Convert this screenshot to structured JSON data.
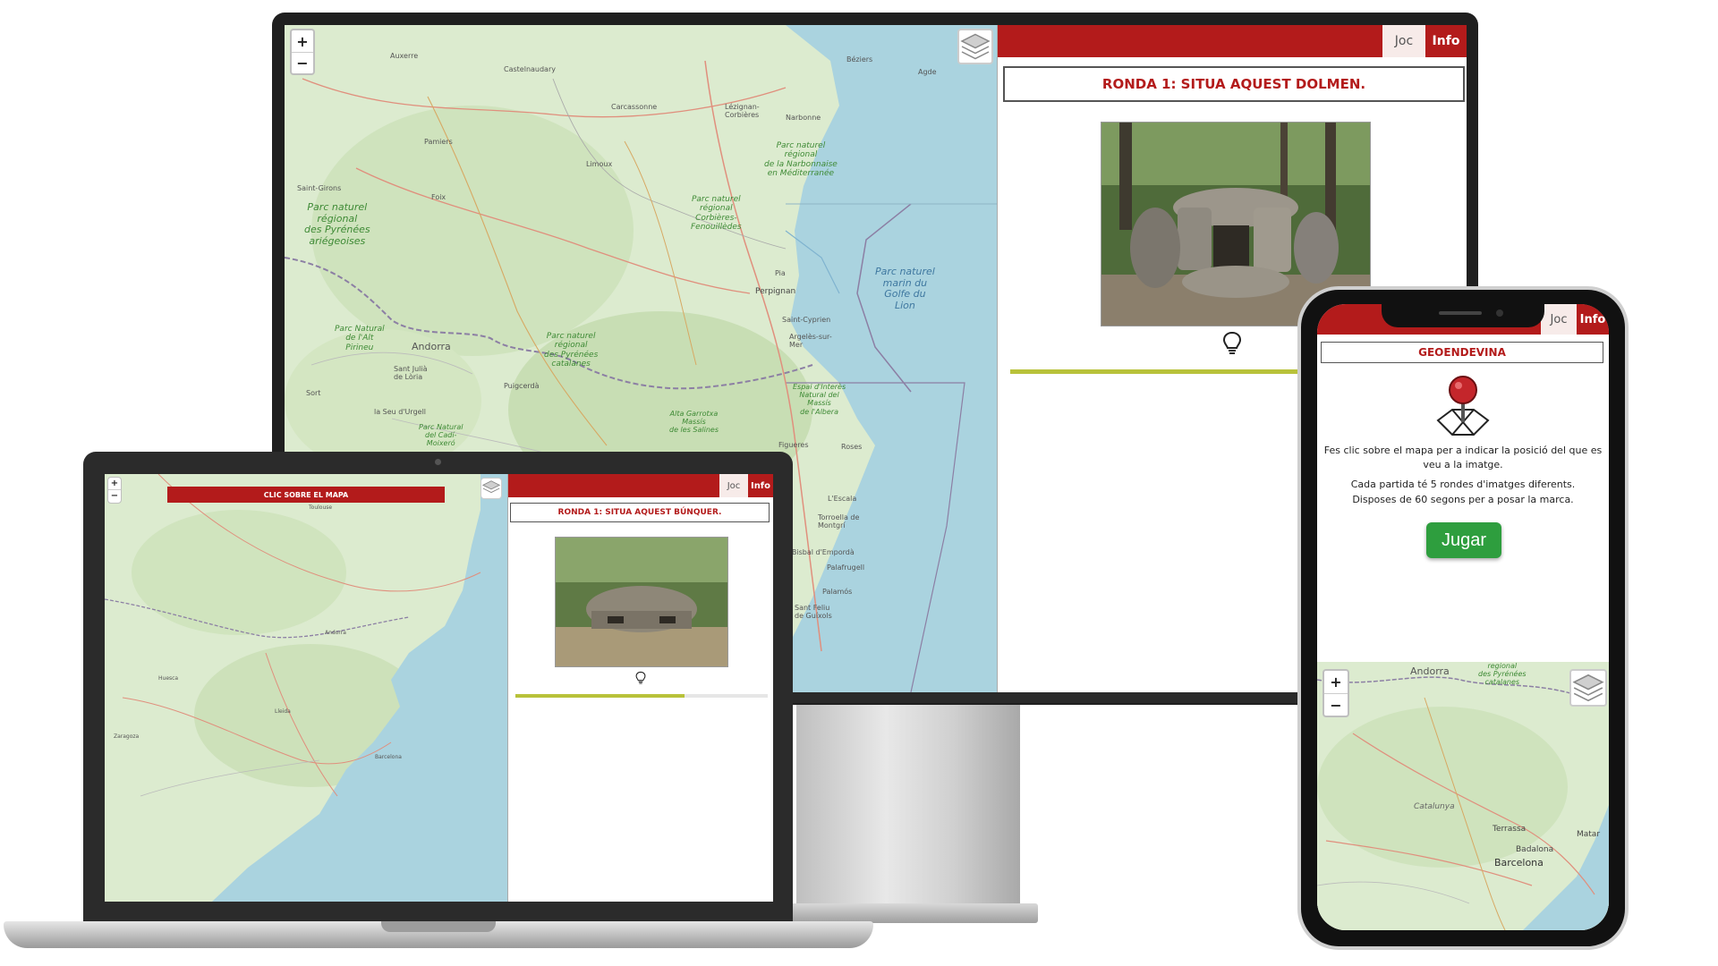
{
  "colors": {
    "brand_red": "#b31b1b",
    "progress": "#b8c23a",
    "play_green": "#2e9e3e",
    "water": "#aad3df",
    "land": "#dcebcf"
  },
  "monitor": {
    "tabs": {
      "joc": "Joc",
      "info": "Info"
    },
    "round_title": "RONDA 1: SITUA AQUEST DOLMEN.",
    "photo_subject": "dolmen",
    "progress": 0.91,
    "zoom": {
      "in": "+",
      "out": "−"
    },
    "map_labels": {
      "auxerre": "Auxerre",
      "castelnaudary": "Castelnaudary",
      "beziers": "Béziers",
      "agde": "Agde",
      "carcassonne": "Carcassonne",
      "lezignan": "Lézignan-\nCorbières",
      "narbonne": "Narbonne",
      "pamiers": "Pamiers",
      "limoux": "Limoux",
      "saint_girons": "Saint-Girons",
      "foix": "Foix",
      "pia": "Pia",
      "perpignan": "Perpignan",
      "andorra": "Andorra",
      "sant_julia": "Sant Julià\nde Lòria",
      "puigcerda": "Puigcerdà",
      "saint_cyprien": "Saint-Cyprien",
      "argeles": "Argelès-sur-\nMer",
      "sort": "Sort",
      "seu": "la Seu d'Urgell",
      "figueres": "Figueres",
      "roses": "Roses",
      "lescala": "L'Escala",
      "torroella": "Torroella de\nMontgrí",
      "bisbal": "La Bisbal d'Empordà",
      "palafrugell": "Palafrugell",
      "palamos": "Palamós",
      "sant_feliu": "Sant Feliu\nde Guíxols"
    },
    "park_labels": {
      "narbonnaise": "Parc naturel\nrégional\nde la Narbonnaise\nen Méditerranée",
      "pyrenees_ariegeoises": "Parc naturel\nrégional\ndes Pyrénées\nariégeoises",
      "corbieres": "Parc naturel\nrégional\nCorbières-\nFenouillèdes",
      "alt_pirineu": "Parc Natural\nde l'Alt\nPirineu",
      "pyrenees_catalanes": "Parc naturel\nrégional\ndes Pyrénées\ncatalanes",
      "albera": "Espai d'Interès\nNatural del\nMassís\nde l'Albera",
      "alta_garrotxa": "Alta Garrotxa\nMassís\nde les Salines",
      "cadi": "Parc Natural\ndel Cadí-\nMoixeró"
    },
    "sea_labels": {
      "golfe": "Parc naturel\nmarin du\nGolfe du\nLion"
    }
  },
  "laptop": {
    "banner": "CLIC SOBRE EL MAPA",
    "tabs": {
      "joc": "Joc",
      "info": "Info"
    },
    "round_title": "RONDA 1: SITUA AQUEST BÚNQUER.",
    "photo_subject": "bunker",
    "progress": 0.67,
    "zoom": {
      "in": "+",
      "out": "−"
    },
    "map_labels": {
      "toulouse": "Toulouse",
      "andorra": "Andorra",
      "huesca": "Huesca",
      "lleida": "Lleida",
      "zaragoza": "Zaragoza",
      "barcelona": "Barcelona"
    }
  },
  "phone": {
    "tabs": {
      "joc": "Joc",
      "info": "Info"
    },
    "title": "GEOENDEVINA",
    "description": "Fes clic sobre el mapa per a indicar la posició del que es veu a la imatge.",
    "rules_line1": "Cada partida té 5 rondes d'imatges diferents.",
    "rules_line2": "Disposes de 60 segons per a posar la marca.",
    "play_button": "Jugar",
    "zoom": {
      "in": "+",
      "out": "−"
    },
    "map_labels": {
      "andorra": "Andorra",
      "park": "regional\ndes Pyrénées\ncatalanes",
      "catalunya": "Catalunya",
      "terrassa": "Terrassa",
      "badalona": "Badalona",
      "barcelona": "Barcelona",
      "mataro": "Matar"
    }
  }
}
